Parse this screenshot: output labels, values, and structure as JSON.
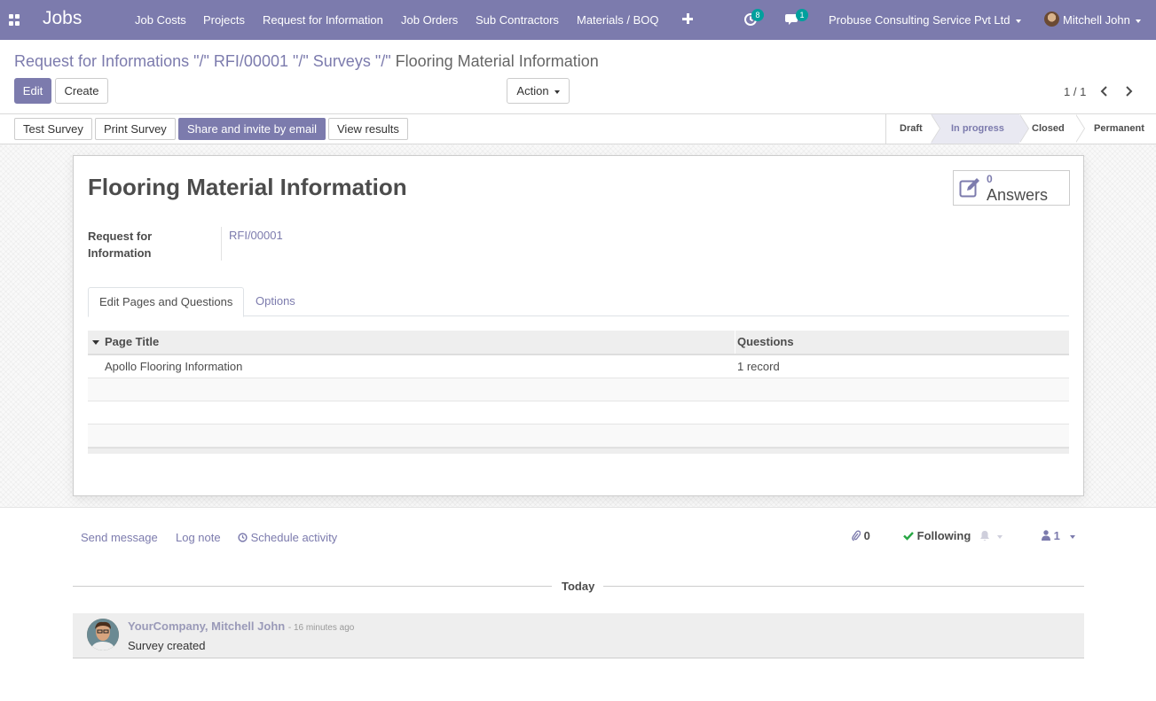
{
  "navbar": {
    "app_title": "Jobs",
    "menu": [
      {
        "label": "Job Costs"
      },
      {
        "label": "Projects"
      },
      {
        "label": "Request for Information"
      },
      {
        "label": "Job Orders"
      },
      {
        "label": "Sub Contractors"
      },
      {
        "label": "Materials / BOQ"
      }
    ],
    "activity_badge": "8",
    "messages_badge": "1",
    "company": "Probuse Consulting Service Pvt Ltd",
    "user": "Mitchell John",
    "color": "#7c7bad"
  },
  "breadcrumb": {
    "items": [
      "Request for Informations",
      "RFI/00001",
      "Surveys"
    ],
    "separator": "\"/\"",
    "current": "Flooring Material Information"
  },
  "controls": {
    "edit_label": "Edit",
    "create_label": "Create",
    "action_label": "Action",
    "pager": "1 / 1"
  },
  "statusbar": {
    "buttons": [
      "Test Survey",
      "Print Survey",
      "Share and invite by email",
      "View results"
    ],
    "stages": [
      "Draft",
      "In progress",
      "Closed",
      "Permanent"
    ],
    "current_stage": "In progress"
  },
  "form": {
    "title": "Flooring Material Information",
    "answers_count": "0",
    "answers_label": "Answers",
    "field_label": "Request for Information",
    "field_value": "RFI/00001",
    "tabs": [
      "Edit Pages and Questions",
      "Options"
    ],
    "table": {
      "headers": [
        "Page Title",
        "Questions"
      ],
      "rows": [
        [
          "Apollo Flooring Information",
          "1 record"
        ]
      ]
    }
  },
  "chatter": {
    "send_message": "Send message",
    "log_note": "Log note",
    "schedule_activity": "Schedule activity",
    "attachments": "0",
    "following": "Following",
    "followers": "1",
    "day": "Today",
    "message": {
      "author": "YourCompany, Mitchell John",
      "date": "16 minutes ago",
      "body": "Survey created"
    }
  }
}
